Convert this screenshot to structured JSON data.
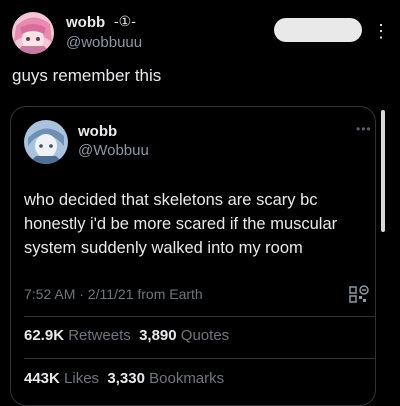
{
  "outer_tweet": {
    "display_name": "wobb",
    "name_decoration": "-①-",
    "handle": "@wobbuuu",
    "text": "guys remember this"
  },
  "quoted_tweet": {
    "display_name": "wobb",
    "handle": "@Wobbuu",
    "text": "who decided that skeletons are scary bc honestly i'd be more scared if the muscular system suddenly walked into my room",
    "timestamp": "7:52 AM · 2/11/21 from Earth",
    "retweets_count": "62.9K",
    "retweets_label": "Retweets",
    "quotes_count": "3,890",
    "quotes_label": "Quotes",
    "likes_count": "443K",
    "likes_label": "Likes",
    "bookmarks_count": "3,330",
    "bookmarks_label": "Bookmarks"
  },
  "icons": {
    "more": "more-vertical-icon",
    "inner_more": "more-horizontal-icon",
    "qr": "qr-code-icon"
  },
  "colors": {
    "background": "#000000",
    "text_primary": "#e7e9ea",
    "text_secondary": "#6e767d",
    "border": "#2f3336"
  }
}
